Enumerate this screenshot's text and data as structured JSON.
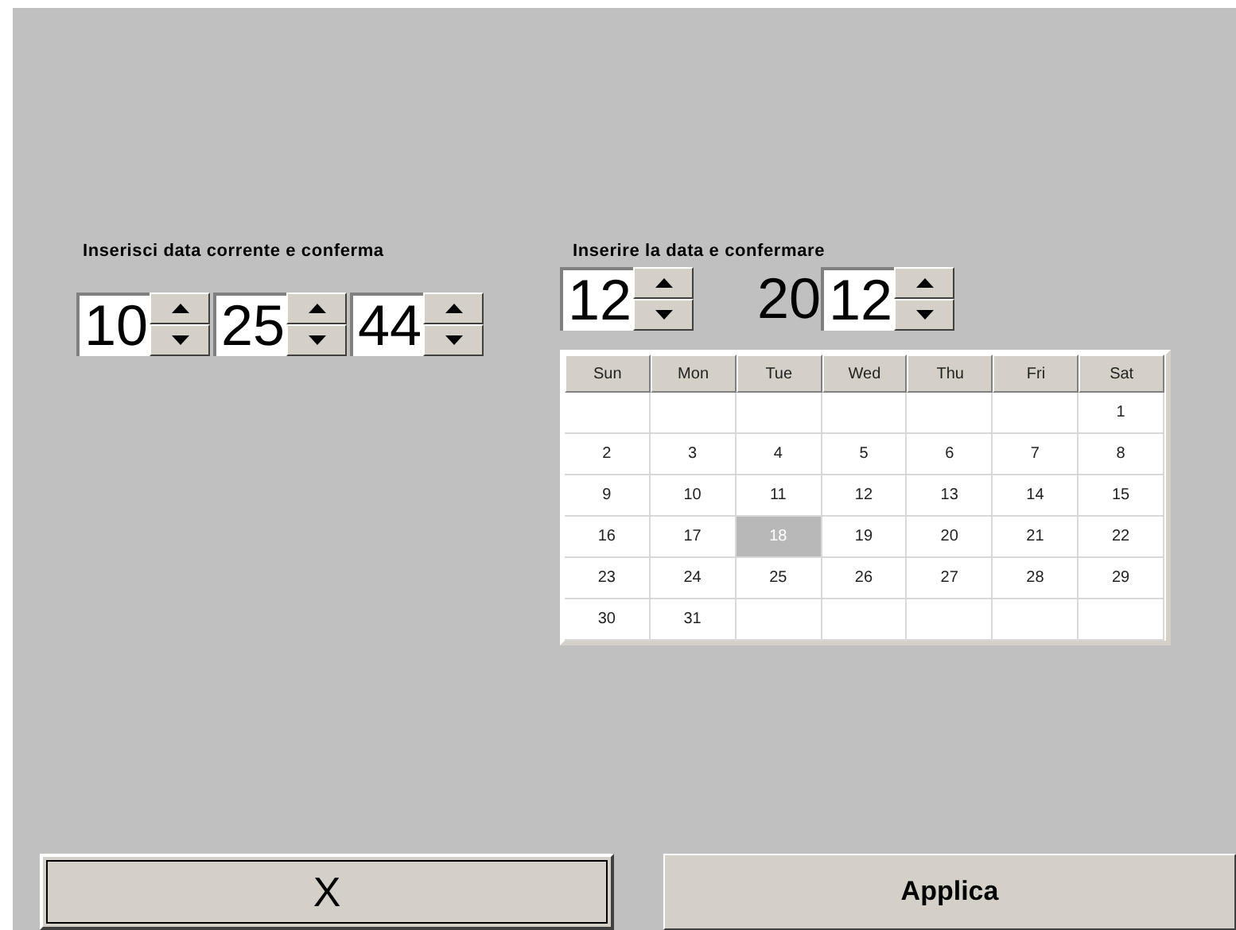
{
  "time_panel": {
    "label": "Inserisci data corrente e conferma",
    "fields": [
      {
        "value": "10"
      },
      {
        "value": "25"
      },
      {
        "value": "44"
      }
    ]
  },
  "date_panel": {
    "label": "Inserire la data e confermare",
    "month": {
      "value": "12"
    },
    "year_prefix": "20",
    "year": {
      "value": "12"
    }
  },
  "calendar": {
    "columns": [
      "Sun",
      "Mon",
      "Tue",
      "Wed",
      "Thu",
      "Fri",
      "Sat"
    ],
    "weeks": [
      [
        {
          "label": "1",
          "selected": false
        }
      ],
      [
        {
          "label": "2",
          "selected": false
        },
        {
          "label": "3",
          "selected": false
        },
        {
          "label": "4",
          "selected": false
        },
        {
          "label": "5",
          "selected": false
        },
        {
          "label": "6",
          "selected": false
        },
        {
          "label": "7",
          "selected": false
        },
        {
          "label": "8",
          "selected": false
        }
      ],
      [
        {
          "label": "9",
          "selected": false
        },
        {
          "label": "10",
          "selected": false
        },
        {
          "label": "11",
          "selected": false
        },
        {
          "label": "12",
          "selected": false
        },
        {
          "label": "13",
          "selected": false
        },
        {
          "label": "14",
          "selected": false
        },
        {
          "label": "15",
          "selected": false
        }
      ],
      [
        {
          "label": "16",
          "selected": false
        },
        {
          "label": "17",
          "selected": false
        },
        {
          "label": "18",
          "selected": true
        },
        {
          "label": "19",
          "selected": false
        },
        {
          "label": "20",
          "selected": false
        },
        {
          "label": "21",
          "selected": false
        },
        {
          "label": "22",
          "selected": false
        }
      ],
      [
        {
          "label": "23",
          "selected": false
        },
        {
          "label": "24",
          "selected": false
        },
        {
          "label": "25",
          "selected": false
        },
        {
          "label": "26",
          "selected": false
        },
        {
          "label": "27",
          "selected": false
        },
        {
          "label": "28",
          "selected": false
        },
        {
          "label": "29",
          "selected": false
        }
      ],
      [
        {
          "label": "30",
          "selected": false
        },
        {
          "label": "31",
          "selected": false
        }
      ]
    ]
  },
  "buttons": [
    {
      "label": "X",
      "focused": true
    },
    {
      "label": "Applica",
      "focused": false
    }
  ]
}
